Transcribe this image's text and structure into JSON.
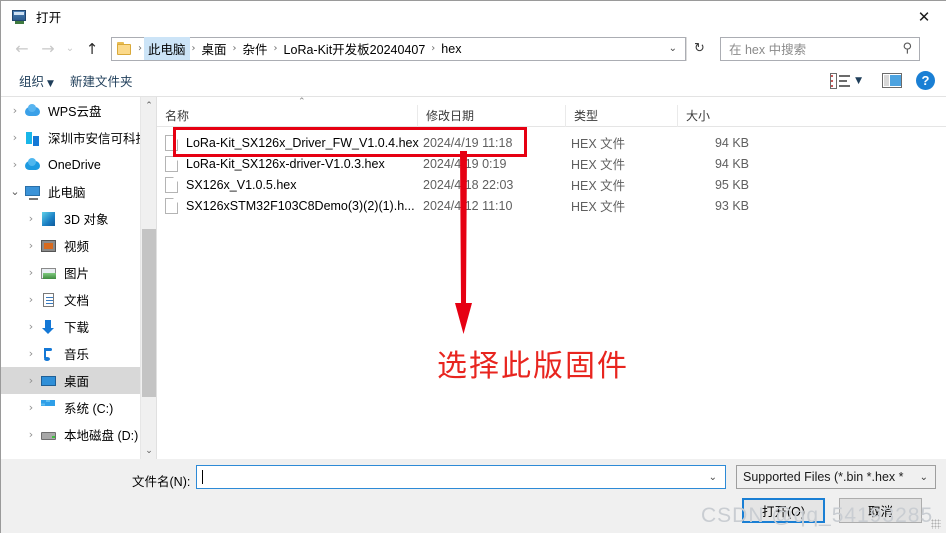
{
  "window": {
    "title": "打开",
    "title_icon": "computer-icon",
    "close_label": "✕"
  },
  "nav": {
    "back_icon": "arrow-left-icon",
    "forward_icon": "arrow-right-icon",
    "recent_icon": "chevron-down-icon",
    "up_icon": "arrow-up-icon",
    "folder_icon": "folder-icon",
    "breadcrumbs": [
      "此电脑",
      "桌面",
      "杂件",
      "LoRa-Kit开发板20240407",
      "hex"
    ],
    "separator": "›",
    "address_caret": "⌄",
    "refresh_icon": "↻"
  },
  "search": {
    "placeholder": "在 hex 中搜索",
    "icon": "search-icon"
  },
  "toolbar": {
    "organize_label": "组织",
    "organize_caret": "▼",
    "new_folder_label": "新建文件夹",
    "view_icon": "view-layout-icon",
    "view_caret": "▼",
    "preview_pane_icon": "preview-pane-icon",
    "help_icon": "help-icon",
    "help_label": "?"
  },
  "sidebar": {
    "items": [
      {
        "label": "WPS云盘",
        "icon": "cloud-icon",
        "chevron": "›",
        "indent": false,
        "selected": false
      },
      {
        "label": "深圳市安信可科技",
        "icon": "building-icon",
        "chevron": "›",
        "indent": false,
        "selected": false
      },
      {
        "label": "OneDrive",
        "icon": "onedrive-cloud-icon",
        "chevron": "›",
        "indent": false,
        "selected": false
      },
      {
        "label": "此电脑",
        "icon": "computer-icon",
        "chevron": "⌄",
        "indent": false,
        "selected": false
      },
      {
        "label": "3D 对象",
        "icon": "3d-objects-icon",
        "chevron": "›",
        "indent": true,
        "selected": false
      },
      {
        "label": "视频",
        "icon": "videos-icon",
        "chevron": "›",
        "indent": true,
        "selected": false
      },
      {
        "label": "图片",
        "icon": "pictures-icon",
        "chevron": "›",
        "indent": true,
        "selected": false
      },
      {
        "label": "文档",
        "icon": "documents-icon",
        "chevron": "›",
        "indent": true,
        "selected": false
      },
      {
        "label": "下载",
        "icon": "downloads-icon",
        "chevron": "›",
        "indent": true,
        "selected": false
      },
      {
        "label": "音乐",
        "icon": "music-icon",
        "chevron": "›",
        "indent": true,
        "selected": false
      },
      {
        "label": "桌面",
        "icon": "desktop-icon",
        "chevron": "›",
        "indent": true,
        "selected": true
      },
      {
        "label": "系统 (C:)",
        "icon": "windows-drive-icon",
        "chevron": "›",
        "indent": true,
        "selected": false
      },
      {
        "label": "本地磁盘 (D:)",
        "icon": "drive-icon",
        "chevron": "›",
        "indent": true,
        "selected": false
      }
    ],
    "scroll_up_icon": "⌃",
    "scroll_down_icon": "⌄"
  },
  "filelist": {
    "sort_caret": "⌃",
    "columns": [
      "名称",
      "修改日期",
      "类型",
      "大小"
    ],
    "rows": [
      {
        "name": "LoRa-Kit_SX126x_Driver_FW_V1.0.4.hex",
        "date": "2024/4/19 11:18",
        "type": "HEX 文件",
        "size": "94 KB",
        "icon": "hex-file-icon"
      },
      {
        "name": "LoRa-Kit_SX126x-driver-V1.0.3.hex",
        "date": "2024/4/19 0:19",
        "type": "HEX 文件",
        "size": "94 KB",
        "icon": "hex-file-icon"
      },
      {
        "name": "SX126x_V1.0.5.hex",
        "date": "2024/4/18 22:03",
        "type": "HEX 文件",
        "size": "95 KB",
        "icon": "hex-file-icon"
      },
      {
        "name": "SX126xSTM32F103C8Demo(3)(2)(1).h...",
        "date": "2024/4/12 11:10",
        "type": "HEX 文件",
        "size": "93 KB",
        "icon": "hex-file-icon"
      }
    ]
  },
  "annotation": {
    "text": "选择此版固件",
    "color": "#e8251f",
    "highlight_color": "#e60012",
    "arrow_icon": "down-arrow-annotation"
  },
  "footer": {
    "filename_label": "文件名(N):",
    "filename_value": "",
    "filename_caret": "⌄",
    "filter_value": "Supported Files (*.bin *.hex *",
    "filter_caret": "⌄",
    "open_button": "打开(O)",
    "cancel_button": "取消"
  },
  "watermark": {
    "text": "CSDN @qq_54193285"
  }
}
